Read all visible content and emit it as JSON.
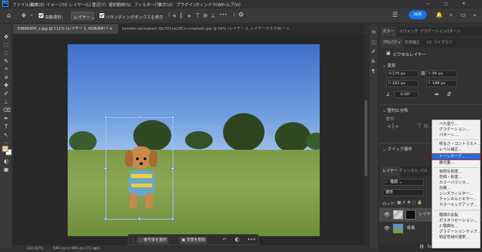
{
  "app": {
    "logo": "Ps"
  },
  "menubar": {
    "items": [
      "ファイル(F)",
      "編集(E)",
      "イメージ(I)",
      "レイヤー(L)",
      "書式(Y)",
      "選択範囲(S)",
      "フィルター(T)",
      "表示(V)",
      "プラグイン",
      "ウィンドウ(W)",
      "ヘルプ(H)"
    ]
  },
  "options": {
    "auto_select_label": "自動選択：",
    "auto_select_value": "レイヤー",
    "bounding_box_label": "バウンディングボックスを表示",
    "more": "•••",
    "share_label": "共有"
  },
  "doc_tabs": [
    {
      "label": "33880905_s.jpg @ 111% (レイヤー 1, RGB/8#) *",
      "close": "×"
    },
    {
      "label": "karsten-winegeart-Qb7D1xw28Cs-unsplash.jpg @ 50% (レイヤー 0, レイヤーマスク/8) *",
      "close": "×"
    }
  ],
  "context_bar": {
    "select_subject": "被写体を選択",
    "remove_bg": "背景を削除",
    "more": "•••"
  },
  "status": {
    "zoom": "110.92%",
    "dims": "640 px x 480 px (72 ppi)"
  },
  "panel_top_tabs": [
    "カラー",
    "スウォッチ",
    "グラデーション",
    "パターン"
  ],
  "panel_mid_tabs": [
    "プロパティ",
    "色調補正",
    "CC ライブラリ"
  ],
  "properties": {
    "layer_type": "ピクセルレイヤー",
    "transform_title": "変形",
    "w": "175 px",
    "x": "95 px",
    "h": "262 px",
    "y": "188 px",
    "angle": "0.00°",
    "align_title": "整列と分布",
    "align_sub": "整列：",
    "quick_actions": "クイック操作"
  },
  "layers_panel": {
    "tabs": [
      "レイヤー",
      "チャンネル",
      "パス"
    ],
    "kind": "種類",
    "blend": "通常",
    "lock_label": "ロック：",
    "layers": [
      {
        "name": "レイヤー 1",
        "selected": true
      },
      {
        "name": "背景",
        "selected": false
      }
    ],
    "footer_icons": [
      "fx",
      "mask",
      "adj",
      "folder",
      "new",
      "trash"
    ]
  },
  "adjust_menu": {
    "groups": [
      [
        "べた塗り...",
        "グラデーション...",
        "パターン..."
      ],
      [
        "明るさ・コントラスト...",
        "レベル補正...",
        "トーンカーブ...",
        "露光量..."
      ],
      [
        "自然な彩度...",
        "色相・彩度...",
        "カラーバランス...",
        "白黒...",
        "レンズフィルター...",
        "チャンネルミキサー...",
        "カラールックアップ..."
      ],
      [
        "階調の反転",
        "ポスタリゼーション...",
        "2 階調化...",
        "グラデーションマップ...",
        "特定色域の選択..."
      ]
    ],
    "highlighted": "トーンカーブ..."
  },
  "colors": {
    "accent": "#1473e6",
    "highlight": "#1f6fd6",
    "callout": "#e01919",
    "fg_swatch": "#f2c994",
    "bg_swatch": "#ffffff"
  }
}
